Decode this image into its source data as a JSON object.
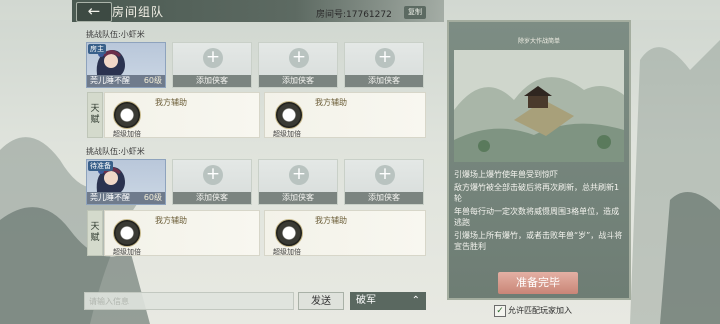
{
  "header": {
    "back_icon": "back-arrow-icon",
    "title": "房间组队",
    "room_number": "房间号:17761272",
    "copy_label": "复制"
  },
  "teams": [
    {
      "label": "挑战队伍:小虾米",
      "hero": {
        "tag": "房主",
        "name": "莞儿睡不醒",
        "level": "60级"
      },
      "empty_slots": [
        "添加侠客",
        "添加侠客",
        "添加侠客"
      ],
      "talent_label": "天赋",
      "skills": [
        {
          "name": "我方辅助",
          "desc": "超级加倍"
        },
        {
          "name": "我方辅助",
          "desc": "超级加倍"
        }
      ]
    },
    {
      "label": "挑战队伍:小虾米",
      "hero": {
        "tag": "待准备",
        "name": "莞儿睡不醒",
        "level": "60级"
      },
      "empty_slots": [
        "添加侠客",
        "添加侠客",
        "添加侠客"
      ],
      "talent_label": "天赋",
      "skills": [
        {
          "name": "我方辅助",
          "desc": "超级加倍"
        },
        {
          "name": "我方辅助",
          "desc": "超级加倍"
        }
      ]
    }
  ],
  "chat": {
    "placeholder": "请输入信息",
    "send_label": "发送",
    "channel": "破军"
  },
  "boss_panel": {
    "title": "除岁大作战简单",
    "rules": [
      "引爆场上爆竹使年兽受到惊吓",
      "敌方爆竹被全部击破后将再次刷新，总共刷新1轮",
      "年兽每行动一定次数将威慑周围3格单位，造成逃跑",
      "引爆场上所有爆竹，或者击败年兽“岁”，战斗将宣告胜利"
    ],
    "ready_label": "准备完毕",
    "allow_match_label": "允许匹配玩家加入",
    "allow_match_checked": true
  }
}
